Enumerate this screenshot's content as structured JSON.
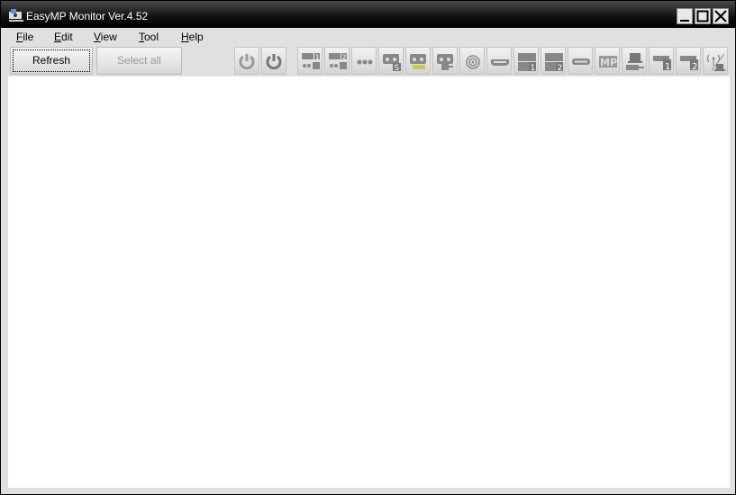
{
  "window": {
    "title": "EasyMP Monitor Ver.4.52",
    "controls": [
      "minimize",
      "maximize",
      "close"
    ]
  },
  "menubar": {
    "items": [
      {
        "label": "File",
        "mnemonic": "F",
        "rest": "ile"
      },
      {
        "label": "Edit",
        "mnemonic": "E",
        "rest": "dit"
      },
      {
        "label": "View",
        "mnemonic": "V",
        "rest": "iew"
      },
      {
        "label": "Tool",
        "mnemonic": "T",
        "rest": "ool"
      },
      {
        "label": "Help",
        "mnemonic": "H",
        "rest": "elp"
      }
    ]
  },
  "toolbar": {
    "refresh_label": "Refresh",
    "select_all_label": "Select all",
    "icons": [
      {
        "name": "power-on-icon",
        "label": "Power On"
      },
      {
        "name": "power-off-icon",
        "label": "Power Off"
      },
      {
        "name": "computer1-icon",
        "label": "Computer 1"
      },
      {
        "name": "computer2-icon",
        "label": "Computer 2"
      },
      {
        "name": "video-icon",
        "label": "Video"
      },
      {
        "name": "s-video-icon",
        "label": "S-Video"
      },
      {
        "name": "component-icon",
        "label": "Component"
      },
      {
        "name": "video-rca-icon",
        "label": "Video (RCA)"
      },
      {
        "name": "bnc-icon",
        "label": "BNC"
      },
      {
        "name": "hdmi-icon",
        "label": "HDMI"
      },
      {
        "name": "dvi1-icon",
        "label": "DVI 1"
      },
      {
        "name": "dvi2-icon",
        "label": "DVI 2"
      },
      {
        "name": "displayport-icon",
        "label": "DisplayPort"
      },
      {
        "name": "mp-icon",
        "label": "MP"
      },
      {
        "name": "usb-display-icon",
        "label": "USB Display"
      },
      {
        "name": "usb1-icon",
        "label": "USB 1"
      },
      {
        "name": "usb2-icon",
        "label": "USB 2"
      },
      {
        "name": "network-icon",
        "label": "Network"
      }
    ]
  }
}
